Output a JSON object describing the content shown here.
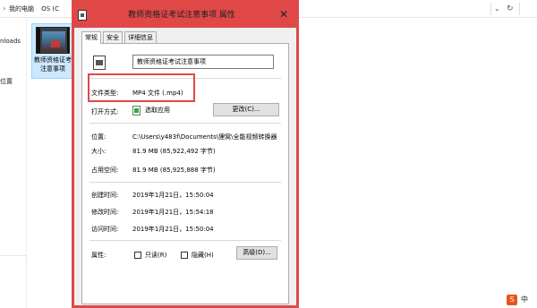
{
  "explorer": {
    "crumbs": [
      "我的电脑",
      "OS (C"
    ],
    "sidebar": [
      "nloads",
      "位置"
    ],
    "file_name_line1": "教师资格证考",
    "file_name_line2": "注意事项"
  },
  "dialog": {
    "title": "教师资格证考试注意事项 属性",
    "close": "✕",
    "tabs": [
      "常规",
      "安全",
      "详细信息"
    ],
    "file_name": "教师资格证考试注意事项",
    "file_type_label": "文件类型:",
    "file_type_value": "MP4 文件 (.mp4)",
    "open_with_label": "打开方式:",
    "open_with_value": "选取应用",
    "change_button": "更改(C)...",
    "location_label": "位置:",
    "location_value": "C:\\Users\\y483f\\Documents\\狸窝\\全能视频转换器",
    "size_label": "大小:",
    "size_value": "81.9 MB (85,922,492 字节)",
    "disk_size_label": "占用空间:",
    "disk_size_value": "81.9 MB (85,925,888 字节)",
    "created_label": "创建时间:",
    "created_value": "2019年1月21日，15:50:04",
    "modified_label": "修改时间:",
    "modified_value": "2019年1月21日，15:54:18",
    "accessed_label": "访问时间:",
    "accessed_value": "2019年1月21日，15:50:04",
    "attributes_label": "属性:",
    "readonly_label": "只读(R)",
    "hidden_label": "隐藏(H)",
    "advanced_button": "高级(D)..."
  },
  "tray": {
    "ime_symbol": "S",
    "ime_text": "中"
  },
  "colors": {
    "highlight_red": "#e04848",
    "selection_blue": "#cce8ff"
  }
}
